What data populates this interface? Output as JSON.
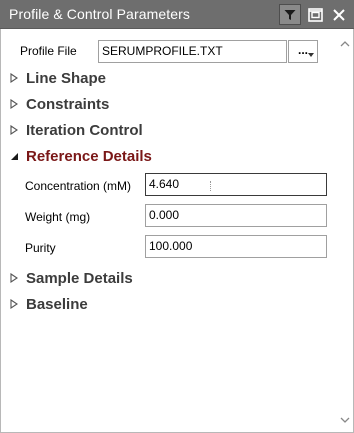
{
  "window": {
    "title": "Profile & Control Parameters",
    "icons": [
      "filter-icon",
      "restore-icon",
      "close-icon"
    ]
  },
  "profile_file": {
    "label": "Profile File",
    "value": "SERUMPROFILE.TXT",
    "browse_label": "..."
  },
  "sections": {
    "line_shape": "Line Shape",
    "constraints": "Constraints",
    "iteration_control": "Iteration Control",
    "reference_details": "Reference Details",
    "sample_details": "Sample Details",
    "baseline": "Baseline"
  },
  "reference_details": {
    "concentration_label": "Concentration (mM)",
    "concentration_value": "4.640",
    "weight_label": "Weight (mg)",
    "weight_value": "0.000",
    "purity_label": "Purity",
    "purity_value": "100.000"
  },
  "colors": {
    "titlebar": "#6e6e6e",
    "expanded_section": "#7a1717",
    "collapsed_section": "#3c3c3c"
  }
}
